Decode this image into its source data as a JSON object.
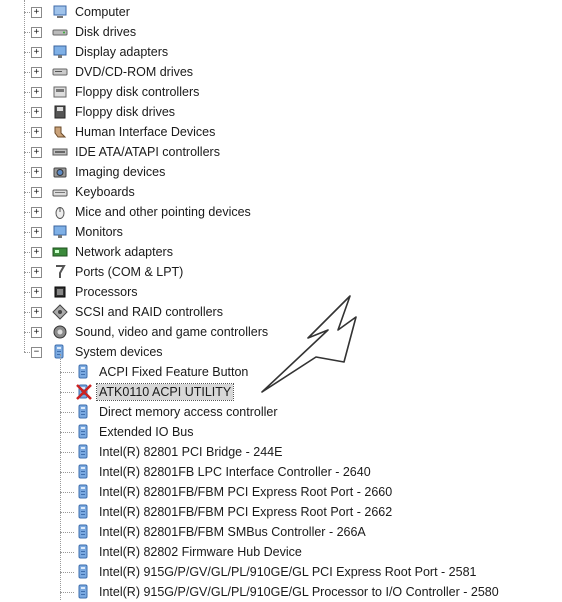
{
  "categories": [
    {
      "label": "Computer",
      "icon": "computer-icon",
      "expander": "+"
    },
    {
      "label": "Disk drives",
      "icon": "disk-drive-icon",
      "expander": "+"
    },
    {
      "label": "Display adapters",
      "icon": "monitor-icon",
      "expander": "+"
    },
    {
      "label": "DVD/CD-ROM drives",
      "icon": "cdrom-icon",
      "expander": "+"
    },
    {
      "label": "Floppy disk controllers",
      "icon": "controller-icon",
      "expander": "+"
    },
    {
      "label": "Floppy disk drives",
      "icon": "floppy-icon",
      "expander": "+"
    },
    {
      "label": "Human Interface Devices",
      "icon": "hid-icon",
      "expander": "+"
    },
    {
      "label": "IDE ATA/ATAPI controllers",
      "icon": "ide-icon",
      "expander": "+"
    },
    {
      "label": "Imaging devices",
      "icon": "camera-icon",
      "expander": "+"
    },
    {
      "label": "Keyboards",
      "icon": "keyboard-icon",
      "expander": "+"
    },
    {
      "label": "Mice and other pointing devices",
      "icon": "mouse-icon",
      "expander": "+"
    },
    {
      "label": "Monitors",
      "icon": "monitor-icon",
      "expander": "+"
    },
    {
      "label": "Network adapters",
      "icon": "network-icon",
      "expander": "+"
    },
    {
      "label": "Ports (COM & LPT)",
      "icon": "port-icon",
      "expander": "+"
    },
    {
      "label": "Processors",
      "icon": "processor-icon",
      "expander": "+"
    },
    {
      "label": "SCSI and RAID controllers",
      "icon": "scsi-icon",
      "expander": "+"
    },
    {
      "label": "Sound, video and game controllers",
      "icon": "sound-icon",
      "expander": "+"
    },
    {
      "label": "System devices",
      "icon": "system-device-icon",
      "expander": "−"
    }
  ],
  "system_devices": [
    {
      "label": "ACPI Fixed Feature Button",
      "icon": "system-device-icon",
      "selected": false
    },
    {
      "label": "ATK0110 ACPI UTILITY",
      "icon": "disabled-device-icon",
      "selected": true
    },
    {
      "label": "Direct memory access controller",
      "icon": "system-device-icon",
      "selected": false
    },
    {
      "label": "Extended IO Bus",
      "icon": "system-device-icon",
      "selected": false
    },
    {
      "label": "Intel(R) 82801 PCI Bridge - 244E",
      "icon": "system-device-icon",
      "selected": false
    },
    {
      "label": "Intel(R) 82801FB LPC Interface Controller - 2640",
      "icon": "system-device-icon",
      "selected": false
    },
    {
      "label": "Intel(R) 82801FB/FBM PCI Express Root Port - 2660",
      "icon": "system-device-icon",
      "selected": false
    },
    {
      "label": "Intel(R) 82801FB/FBM PCI Express Root Port - 2662",
      "icon": "system-device-icon",
      "selected": false
    },
    {
      "label": "Intel(R) 82801FB/FBM SMBus Controller - 266A",
      "icon": "system-device-icon",
      "selected": false
    },
    {
      "label": "Intel(R) 82802 Firmware Hub Device",
      "icon": "system-device-icon",
      "selected": false
    },
    {
      "label": "Intel(R) 915G/P/GV/GL/PL/910GE/GL PCI Express Root Port - 2581",
      "icon": "system-device-icon",
      "selected": false
    },
    {
      "label": "Intel(R) 915G/P/GV/GL/PL/910GE/GL Processor to I/O Controller - 2580",
      "icon": "system-device-icon",
      "selected": false
    }
  ],
  "colors": {
    "arrow": "#333333",
    "selection_bg": "#d8d8d8",
    "disabled_x": "#cc2222"
  }
}
